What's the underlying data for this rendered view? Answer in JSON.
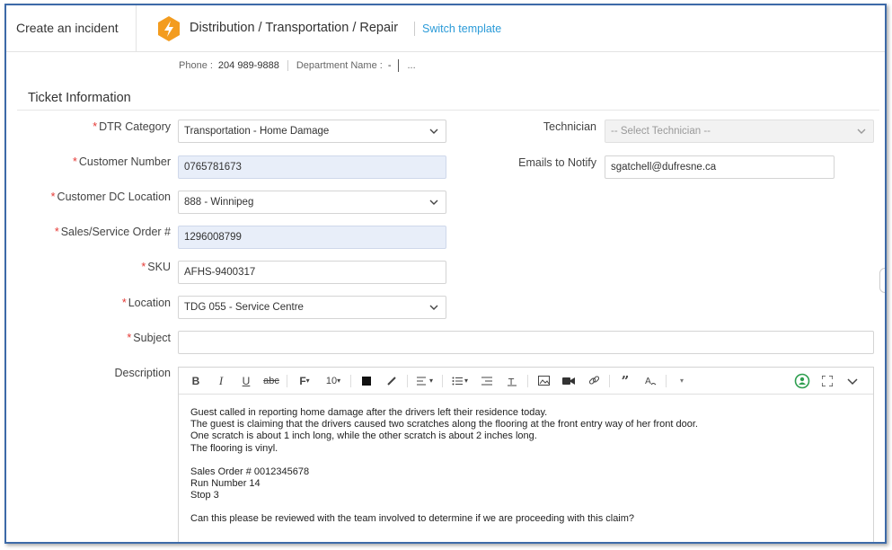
{
  "header": {
    "title": "Create an incident",
    "template_name": "Distribution / Transportation / Repair",
    "switch_template": "Switch template"
  },
  "subinfo": {
    "phone_label": "Phone :",
    "phone_value": "204 989-9888",
    "department_label": "Department Name :",
    "department_value": "-",
    "more": "..."
  },
  "section": {
    "title": "Ticket Information"
  },
  "fields": {
    "dtr_category": {
      "label": "DTR Category",
      "value": "Transportation - Home Damage"
    },
    "customer_number": {
      "label": "Customer Number",
      "value": "0765781673"
    },
    "customer_dc_location": {
      "label": "Customer DC Location",
      "value": "888 - Winnipeg"
    },
    "sales_service_order": {
      "label": "Sales/Service Order #",
      "value": "1296008799"
    },
    "sku": {
      "label": "SKU",
      "value": "AFHS-9400317"
    },
    "location": {
      "label": "Location",
      "value": "TDG 055 - Service Centre"
    },
    "subject": {
      "label": "Subject",
      "value": ""
    },
    "description": {
      "label": "Description"
    },
    "technician": {
      "label": "Technician",
      "placeholder": "-- Select Technician --"
    },
    "emails_to_notify": {
      "label": "Emails to Notify",
      "value": "sgatchell@dufresne.ca"
    }
  },
  "required_marker": "*",
  "editor": {
    "font_size": "10",
    "font_label": "F",
    "lines": [
      "Guest called in reporting home damage after the drivers left their residence today.",
      "The guest is claiming that the drivers caused two scratches along the flooring at the front entry way of her front door.",
      "One scratch is about 1 inch long, while the other scratch is about 2 inches long.",
      "The flooring is vinyl.",
      "",
      "Sales Order # 0012345678",
      "Run Number 14",
      "Stop 3",
      "",
      "Can this please be reviewed with the team involved to determine if we are proceeding with this claim?"
    ]
  },
  "colors": {
    "frame_border": "#3d6aa8",
    "link": "#2b9bd8",
    "required": "#e53935",
    "logo": "#f39c1f",
    "filled_field": "#e8eef9",
    "assistant_icon": "#2e9e4f"
  }
}
